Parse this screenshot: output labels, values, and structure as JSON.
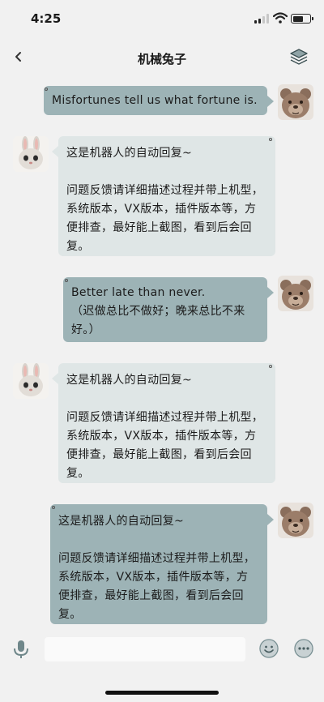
{
  "status_bar": {
    "time": "4:25"
  },
  "nav": {
    "title": "机械兔子"
  },
  "messages": [
    {
      "side": "out",
      "text": "Misfortunes tell us what fortune is."
    },
    {
      "side": "in",
      "text": "这是机器人的自动回复~\n\n问题反馈请详细描述过程并带上机型，系统版本，VX版本，插件版本等，方便排查，最好能上截图，看到后会回复。"
    },
    {
      "side": "out",
      "text": "Better late than never.\n（迟做总比不做好；晚来总比不来好。）"
    },
    {
      "side": "in",
      "text": "这是机器人的自动回复~\n\n问题反馈请详细描述过程并带上机型，系统版本，VX版本，插件版本等，方便排查，最好能上截图，看到后会回复。"
    },
    {
      "side": "out",
      "text": "这是机器人的自动回复~\n\n问题反馈请详细描述过程并带上机型，系统版本，VX版本，插件版本等，方便排查，最好能上截图，看到后会回复。"
    }
  ],
  "input": {
    "placeholder": ""
  },
  "icons": {
    "back": "chevron-left-icon",
    "layers": "layers-icon",
    "mic": "microphone-icon",
    "emoji": "smiley-icon",
    "more": "more-icon"
  },
  "colors": {
    "outgoing_bubble": "#9db3b6",
    "incoming_bubble": "#dfe6e6",
    "background": "#f1f1f1"
  }
}
